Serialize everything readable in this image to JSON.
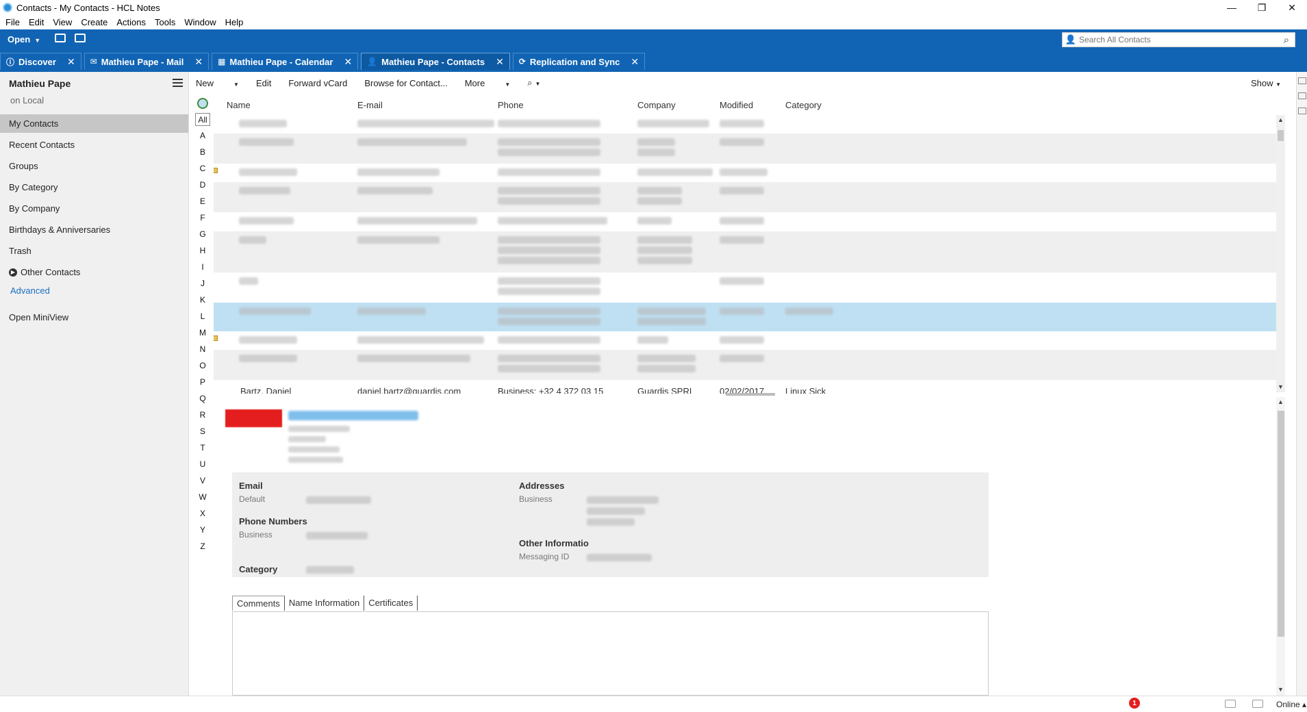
{
  "window": {
    "title": "Contacts - My Contacts - HCL Notes",
    "controls": [
      "—",
      "❐",
      "✕"
    ]
  },
  "menu": [
    "File",
    "Edit",
    "View",
    "Create",
    "Actions",
    "Tools",
    "Window",
    "Help"
  ],
  "header": {
    "open_label": "Open",
    "search_placeholder": "Search All Contacts"
  },
  "tabs": [
    {
      "label": "Discover",
      "icon": "info-icon"
    },
    {
      "label": "Mathieu Pape - Mail",
      "icon": "mail-icon"
    },
    {
      "label": "Mathieu Pape - Calendar",
      "icon": "calendar-icon"
    },
    {
      "label": "Mathieu Pape - Contacts",
      "icon": "person-icon",
      "active": true
    },
    {
      "label": "Replication and Sync",
      "icon": "sync-icon"
    }
  ],
  "sidebar": {
    "owner": "Mathieu Pape",
    "location": "on Local",
    "items": [
      "My Contacts",
      "Recent Contacts",
      "Groups",
      "By Category",
      "By Company",
      "Birthdays & Anniversaries",
      "Trash",
      "Other Contacts"
    ],
    "advanced": "Advanced",
    "miniview": "Open MiniView"
  },
  "toolbar": {
    "new": "New",
    "edit": "Edit",
    "forward": "Forward vCard",
    "browse": "Browse for Contact...",
    "more": "More",
    "show": "Show"
  },
  "alphabet": {
    "all": "All",
    "letters": [
      "A",
      "B",
      "C",
      "D",
      "E",
      "F",
      "G",
      "H",
      "I",
      "J",
      "K",
      "L",
      "M",
      "N",
      "O",
      "P",
      "Q",
      "R",
      "S",
      "T",
      "U",
      "V",
      "W",
      "X",
      "Y",
      "Z"
    ]
  },
  "table": {
    "columns": [
      "Name",
      "E-mail",
      "Phone",
      "Company",
      "Modified",
      "Category"
    ],
    "partial_row": {
      "name": "Bartz, Daniel",
      "email": "daniel.bartz@guardis.com",
      "phone": "Business: +32 4 372 03 15",
      "company": "Guardis SPRL",
      "modified": "02/02/2017",
      "category": "Linux Sick"
    }
  },
  "preview": {
    "email_label": "Email",
    "email_default": "Default",
    "phone_label": "Phone Numbers",
    "phone_business": "Business",
    "category_label": "Category",
    "addresses_label": "Addresses",
    "address_business": "Business",
    "other_label": "Other Informatio",
    "messaging_label": "Messaging ID",
    "subtabs": [
      "Comments",
      "Name Information",
      "Certificates"
    ]
  },
  "status": {
    "notifications": "1",
    "online": "Online"
  },
  "colors": {
    "brand_blue": "#1164b4",
    "selected_row": "#bfe0f3"
  }
}
